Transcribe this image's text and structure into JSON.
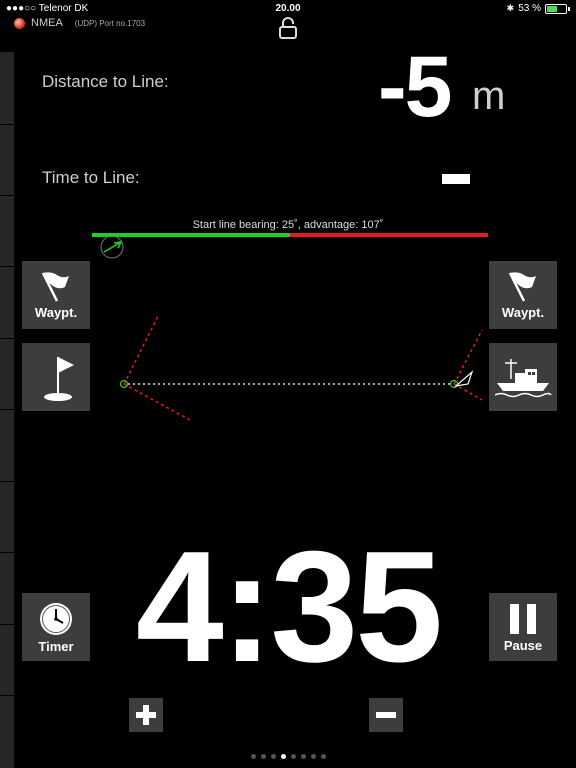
{
  "status_bar": {
    "carrier": "●●●○○ Telenor DK",
    "time": "20.00",
    "battery_text": "53 %",
    "battery_level_percent": 53
  },
  "connection": {
    "label": "NMEA",
    "detail": "(UDP) Port no.1703"
  },
  "distance": {
    "label": "Distance to Line:",
    "value": "-5",
    "unit": "m"
  },
  "time_to_line": {
    "label": "Time to Line:"
  },
  "start_line": {
    "bearing_text": "Start line bearing: 25˚, advantage: 107˚"
  },
  "buttons": {
    "waypoint_left_label": "Waypt.",
    "waypoint_right_label": "Waypt.",
    "timer_label": "Timer",
    "pause_label": "Pause"
  },
  "timer": {
    "value": "4:35"
  },
  "pager": {
    "count": 8,
    "active_index": 3
  },
  "colors": {
    "favored_green": "#1fd11f",
    "unfavored_red": "#e41c1c",
    "button_bg": "#3d3d3d"
  },
  "icons": {
    "lock": "lock-open-icon",
    "flag": "flag-icon",
    "pin_flag": "pin-flag-icon",
    "boat": "committee-boat-icon",
    "clock": "clock-icon",
    "pause": "pause-icon",
    "plus": "plus-icon",
    "minus": "minus-icon"
  }
}
